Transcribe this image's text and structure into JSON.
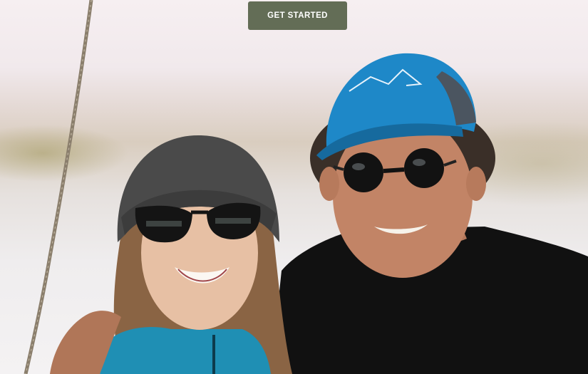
{
  "cta": {
    "label": "GET STARTED"
  },
  "photo": {
    "subject": "two-people-smiling-on-sailboat"
  },
  "colors": {
    "cta_bg": "#636d56",
    "cap_blue": "#1e88c8",
    "beanie": "#4a4a4a",
    "shirt": "#111111",
    "jacket": "#1f8fb4"
  }
}
